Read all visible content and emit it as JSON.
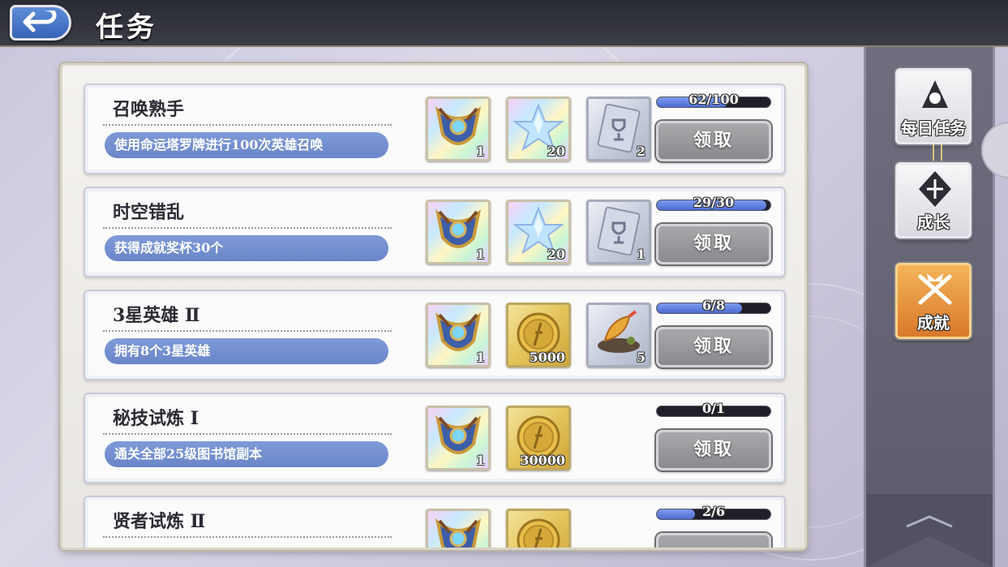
{
  "header": {
    "title": "任务"
  },
  "tasks": [
    {
      "name": "召唤熟手",
      "desc": "使用命运塔罗牌进行100次英雄召唤",
      "progress_text": "62/100",
      "progress": 0.62,
      "rewards": [
        {
          "icon": "hero-crest-icon",
          "qty": "1",
          "style": "rainbow"
        },
        {
          "icon": "star-icon",
          "qty": "20",
          "style": "rainbow"
        },
        {
          "icon": "trophy-card-icon",
          "qty": "2",
          "style": "silver"
        }
      ],
      "claim_label": "领取"
    },
    {
      "name": "时空错乱",
      "desc": "获得成就奖杯30个",
      "progress_text": "29/30",
      "progress": 0.967,
      "rewards": [
        {
          "icon": "hero-crest-icon",
          "qty": "1",
          "style": "rainbow"
        },
        {
          "icon": "star-icon",
          "qty": "20",
          "style": "rainbow"
        },
        {
          "icon": "trophy-card-icon",
          "qty": "1",
          "style": "silver"
        }
      ],
      "claim_label": "领取"
    },
    {
      "name": "3星英雄 Ⅱ",
      "desc": "拥有8个3星英雄",
      "progress_text": "6/8",
      "progress": 0.75,
      "rewards": [
        {
          "icon": "hero-crest-icon",
          "qty": "1",
          "style": "rainbow"
        },
        {
          "icon": "gold-coin-icon",
          "qty": "5000",
          "style": "gold"
        },
        {
          "icon": "tempura-food-icon",
          "qty": "5",
          "style": "silver"
        }
      ],
      "claim_label": "领取"
    },
    {
      "name": "秘技试炼 Ⅰ",
      "desc": "通关全部25级图书馆副本",
      "progress_text": "0/1",
      "progress": 0,
      "rewards": [
        {
          "icon": "hero-crest-icon",
          "qty": "1",
          "style": "rainbow"
        },
        {
          "icon": "gold-coin-icon",
          "qty": "30000",
          "style": "gold"
        }
      ],
      "claim_label": "领取"
    },
    {
      "name": "贤者试炼 Ⅱ",
      "desc": "",
      "progress_text": "2/6",
      "progress": 0.333,
      "rewards": [
        {
          "icon": "hero-crest-icon",
          "qty": "",
          "style": "rainbow"
        },
        {
          "icon": "gold-coin-icon",
          "qty": "",
          "style": "gold"
        }
      ],
      "claim_label": ""
    }
  ],
  "nav": [
    {
      "label": "每日任务",
      "icon": "daily-task-icon",
      "active": false
    },
    {
      "label": "成长",
      "icon": "growth-icon",
      "active": false
    },
    {
      "label": "成就",
      "icon": "achievement-icon",
      "active": true
    }
  ],
  "colors": {
    "accent_blue": "#6a86c8",
    "active_tab": "#d9782a",
    "progress_fill": "#4c6cd0"
  }
}
